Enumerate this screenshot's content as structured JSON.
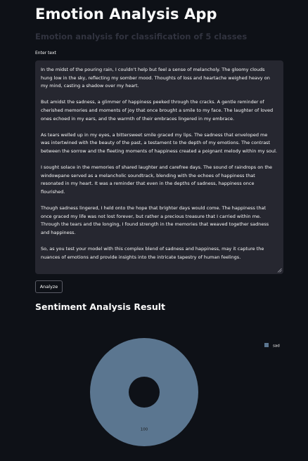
{
  "app": {
    "title": "Emotion Analysis App",
    "subtitle": "Emotion analysis for classification of 5 classes"
  },
  "input": {
    "label": "Enter text",
    "paragraphs": [
      "In the midst of the pouring rain, I couldn't help but feel a sense of melancholy. The gloomy clouds hung low in the sky, reflecting my somber mood. Thoughts of loss and heartache weighed heavy on my mind, casting a shadow over my heart.",
      "But amidst the sadness, a glimmer of happiness peeked through the cracks. A gentle reminder of cherished memories and moments of joy that once brought a smile to my face. The laughter of loved ones echoed in my ears, and the warmth of their embraces lingered in my embrace.",
      "As tears welled up in my eyes, a bittersweet smile graced my lips. The sadness that enveloped me was intertwined with the beauty of the past, a testament to the depth of my emotions. The contrast between the sorrow and the fleeting moments of happiness created a poignant melody within my soul.",
      "I sought solace in the memories of shared laughter and carefree days. The sound of raindrops on the windowpane served as a melancholic soundtrack, blending with the echoes of happiness that resonated in my heart. It was a reminder that even in the depths of sadness, happiness once flourished.",
      "Though sadness lingered, I held onto the hope that brighter days would come. The happiness that once graced my life was not lost forever, but rather a precious treasure that I carried within me. Through the tears and the longing, I found strength in the memories that weaved together sadness and happiness.",
      "So, as you test your model with this complex blend of sadness and happiness, may it capture the nuances of emotions and provide insights into the intricate tapestry of human feelings."
    ]
  },
  "analyze_button": {
    "label": "Analyze"
  },
  "result": {
    "heading": "Sentiment Analysis Result"
  },
  "chart_data": {
    "type": "pie",
    "variant": "donut",
    "categories": [
      "sad"
    ],
    "values": [
      100
    ],
    "data_labels": [
      "100"
    ],
    "colors": [
      "#5b7690"
    ],
    "legend_position": "top-right",
    "title": "",
    "xlabel": "",
    "ylabel": ""
  },
  "colors": {
    "background": "#0e1117",
    "textarea_bg": "#262730",
    "text": "#fafafa",
    "subtitle": "#31333f",
    "slice": "#5b7690"
  }
}
